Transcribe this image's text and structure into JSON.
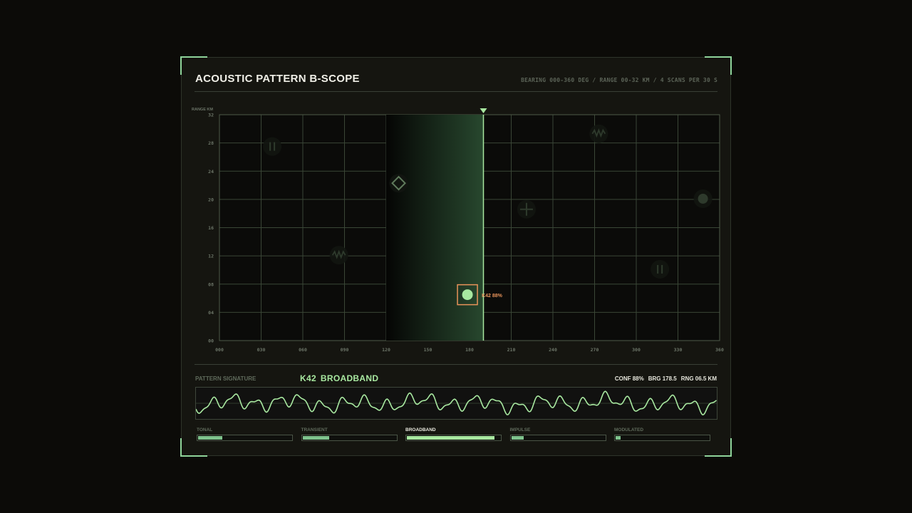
{
  "header": {
    "title": "ACOUSTIC PATTERN B-SCOPE",
    "subtitle": "BEARING 000-360 DEG / RANGE 00-32 KM / 4 SCANS PER 30 S"
  },
  "scope": {
    "y_axis_title": "RANGE KM",
    "y_ticks": [
      "32",
      "28",
      "24",
      "20",
      "16",
      "12",
      "08",
      "04",
      "00"
    ],
    "x_ticks": [
      "000",
      "030",
      "060",
      "090",
      "120",
      "150",
      "180",
      "210",
      "240",
      "270",
      "300",
      "330",
      "360"
    ],
    "sweep_bearing": 190,
    "sweep_trail_from": 120,
    "contacts": [
      {
        "bearing": 38,
        "range": 27.5,
        "icon": "pause-bars-icon"
      },
      {
        "bearing": 86,
        "range": 12.1,
        "icon": "wave-icon"
      },
      {
        "bearing": 129,
        "range": 22.3,
        "icon": "diamond-icon"
      },
      {
        "bearing": 221,
        "range": 18.6,
        "icon": "plus-icon"
      },
      {
        "bearing": 273,
        "range": 29.3,
        "icon": "wave-icon"
      },
      {
        "bearing": 317,
        "range": 10.1,
        "icon": "pause-bars-icon"
      },
      {
        "bearing": 348,
        "range": 20.1,
        "icon": "dot-icon"
      }
    ],
    "selected": {
      "bearing": 178.5,
      "range": 6.5,
      "icon": "dot-icon",
      "label": "K42 88%"
    }
  },
  "signature": {
    "label": "PATTERN SIGNATURE",
    "id": "K42",
    "class": "BROADBAND",
    "conf": "CONF 88%",
    "brg": "BRG 178.5",
    "rng": "RNG 06.5 KM"
  },
  "categories": [
    {
      "label": "TONAL",
      "value": 0.27,
      "active": false
    },
    {
      "label": "TRANSIENT",
      "value": 0.3,
      "active": false
    },
    {
      "label": "BROADBAND",
      "value": 0.94,
      "active": true
    },
    {
      "label": "IMPULSE",
      "value": 0.15,
      "active": false
    },
    {
      "label": "MODULATED",
      "value": 0.07,
      "active": false
    }
  ],
  "colors": {
    "accent": "#a8e8a0",
    "grid": "#3a4636",
    "highlight": "#e8935a",
    "contact": "#2e3a2c"
  }
}
